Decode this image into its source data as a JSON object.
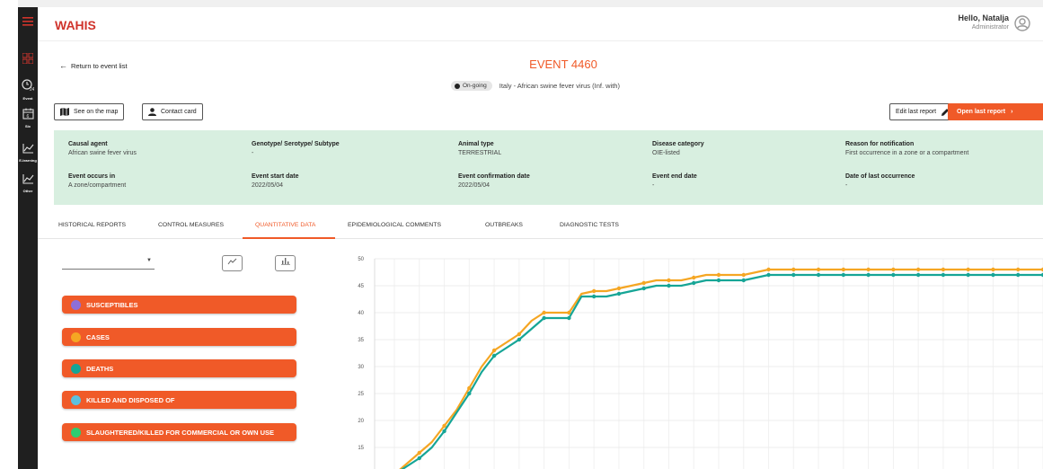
{
  "app": {
    "brand": "WAHIS"
  },
  "user": {
    "greeting": "Hello, Natalja",
    "role": "Administrator"
  },
  "sidebar": {
    "items": [
      {
        "icon": "menu-icon",
        "label": ""
      },
      {
        "icon": "grid-icon",
        "label": ""
      },
      {
        "icon": "clock-24-icon",
        "label": "Event"
      },
      {
        "icon": "calendar-icon",
        "label": "Six"
      },
      {
        "icon": "chart-line-icon",
        "label": "E-learning"
      },
      {
        "icon": "chart-line-icon",
        "label": "Other"
      }
    ]
  },
  "nav": {
    "back_label": "Return to event list"
  },
  "event": {
    "title": "EVENT 4460",
    "status": "On-going",
    "subtitle": "Italy - African swine fever virus (Inf. with)"
  },
  "actions": {
    "map_label": "See on the map",
    "contact_label": "Contact card",
    "edit_label": "Edit last report",
    "open_label": "Open last report"
  },
  "details": {
    "causal_agent": {
      "label": "Causal agent",
      "value": "African swine fever virus"
    },
    "genotype": {
      "label": "Genotype/ Serotype/ Subtype",
      "value": "-"
    },
    "animal_type": {
      "label": "Animal type",
      "value": "TERRESTRIAL"
    },
    "disease_category": {
      "label": "Disease category",
      "value": "OIE-listed"
    },
    "reason": {
      "label": "Reason for notification",
      "value": "First occurrence in a zone or a compartment"
    },
    "occurs_in": {
      "label": "Event occurs in",
      "value": "A zone/compartment"
    },
    "start_date": {
      "label": "Event start date",
      "value": "2022/05/04"
    },
    "confirmation_date": {
      "label": "Event confirmation date",
      "value": "2022/05/04"
    },
    "end_date": {
      "label": "Event end date",
      "value": "-"
    },
    "last_occurrence": {
      "label": "Date of last occurrence",
      "value": "-"
    }
  },
  "tabs": [
    {
      "label": "HISTORICAL REPORTS",
      "active": false
    },
    {
      "label": "CONTROL MEASURES",
      "active": false
    },
    {
      "label": "QUANTITATIVE DATA",
      "active": true
    },
    {
      "label": "EPIDEMIOLOGICAL COMMENTS",
      "active": false
    },
    {
      "label": "OUTBREAKS",
      "active": false
    },
    {
      "label": "DIAGNOSTIC TESTS",
      "active": false
    }
  ],
  "controls": {
    "select_value": "",
    "line_icon": "line-chart-icon",
    "bar_icon": "bar-chart-icon"
  },
  "series_toggles": [
    {
      "label": "SUSCEPTIBLES",
      "color": "#8e6fd8"
    },
    {
      "label": "CASES",
      "color": "#f5a623"
    },
    {
      "label": "DEATHS",
      "color": "#16a596"
    },
    {
      "label": "KILLED AND DISPOSED OF",
      "color": "#5bc0de"
    },
    {
      "label": "SLAUGHTERED/KILLED FOR COMMERCIAL OR OWN USE",
      "color": "#2ecc71"
    }
  ],
  "colors": {
    "accent": "#f05a28",
    "brand": "#d0342c",
    "info_bg": "#d8efe0"
  },
  "chart_data": {
    "type": "line",
    "ylim": [
      10,
      50
    ],
    "yticks": [
      10,
      15,
      20,
      25,
      30,
      35,
      40,
      45,
      50
    ],
    "grid": true,
    "series": [
      {
        "name": "CASES",
        "color": "#f5a623",
        "values": [
          10,
          12,
          14,
          16,
          19,
          22,
          26,
          30,
          33,
          34.5,
          36,
          38.5,
          40,
          40,
          40,
          43.5,
          44,
          44,
          44.5,
          45,
          45.5,
          46,
          46,
          46,
          46.5,
          47,
          47,
          47,
          47,
          47.5,
          48,
          48,
          48,
          48,
          48,
          48,
          48,
          48,
          48,
          48,
          48,
          48,
          48,
          48,
          48,
          48,
          48,
          48,
          48,
          48,
          48,
          48,
          48
        ]
      },
      {
        "name": "DEATHS",
        "color": "#16a596",
        "values": [
          10,
          11.5,
          13,
          15,
          18,
          21.5,
          25,
          29,
          32,
          33.5,
          35,
          37,
          39,
          39,
          39,
          43,
          43,
          43,
          43.5,
          44,
          44.5,
          45,
          45,
          45,
          45.5,
          46,
          46,
          46,
          46,
          46.5,
          47,
          47,
          47,
          47,
          47,
          47,
          47,
          47,
          47,
          47,
          47,
          47,
          47,
          47,
          47,
          47,
          47,
          47,
          47,
          47,
          47,
          47,
          47
        ]
      }
    ]
  }
}
